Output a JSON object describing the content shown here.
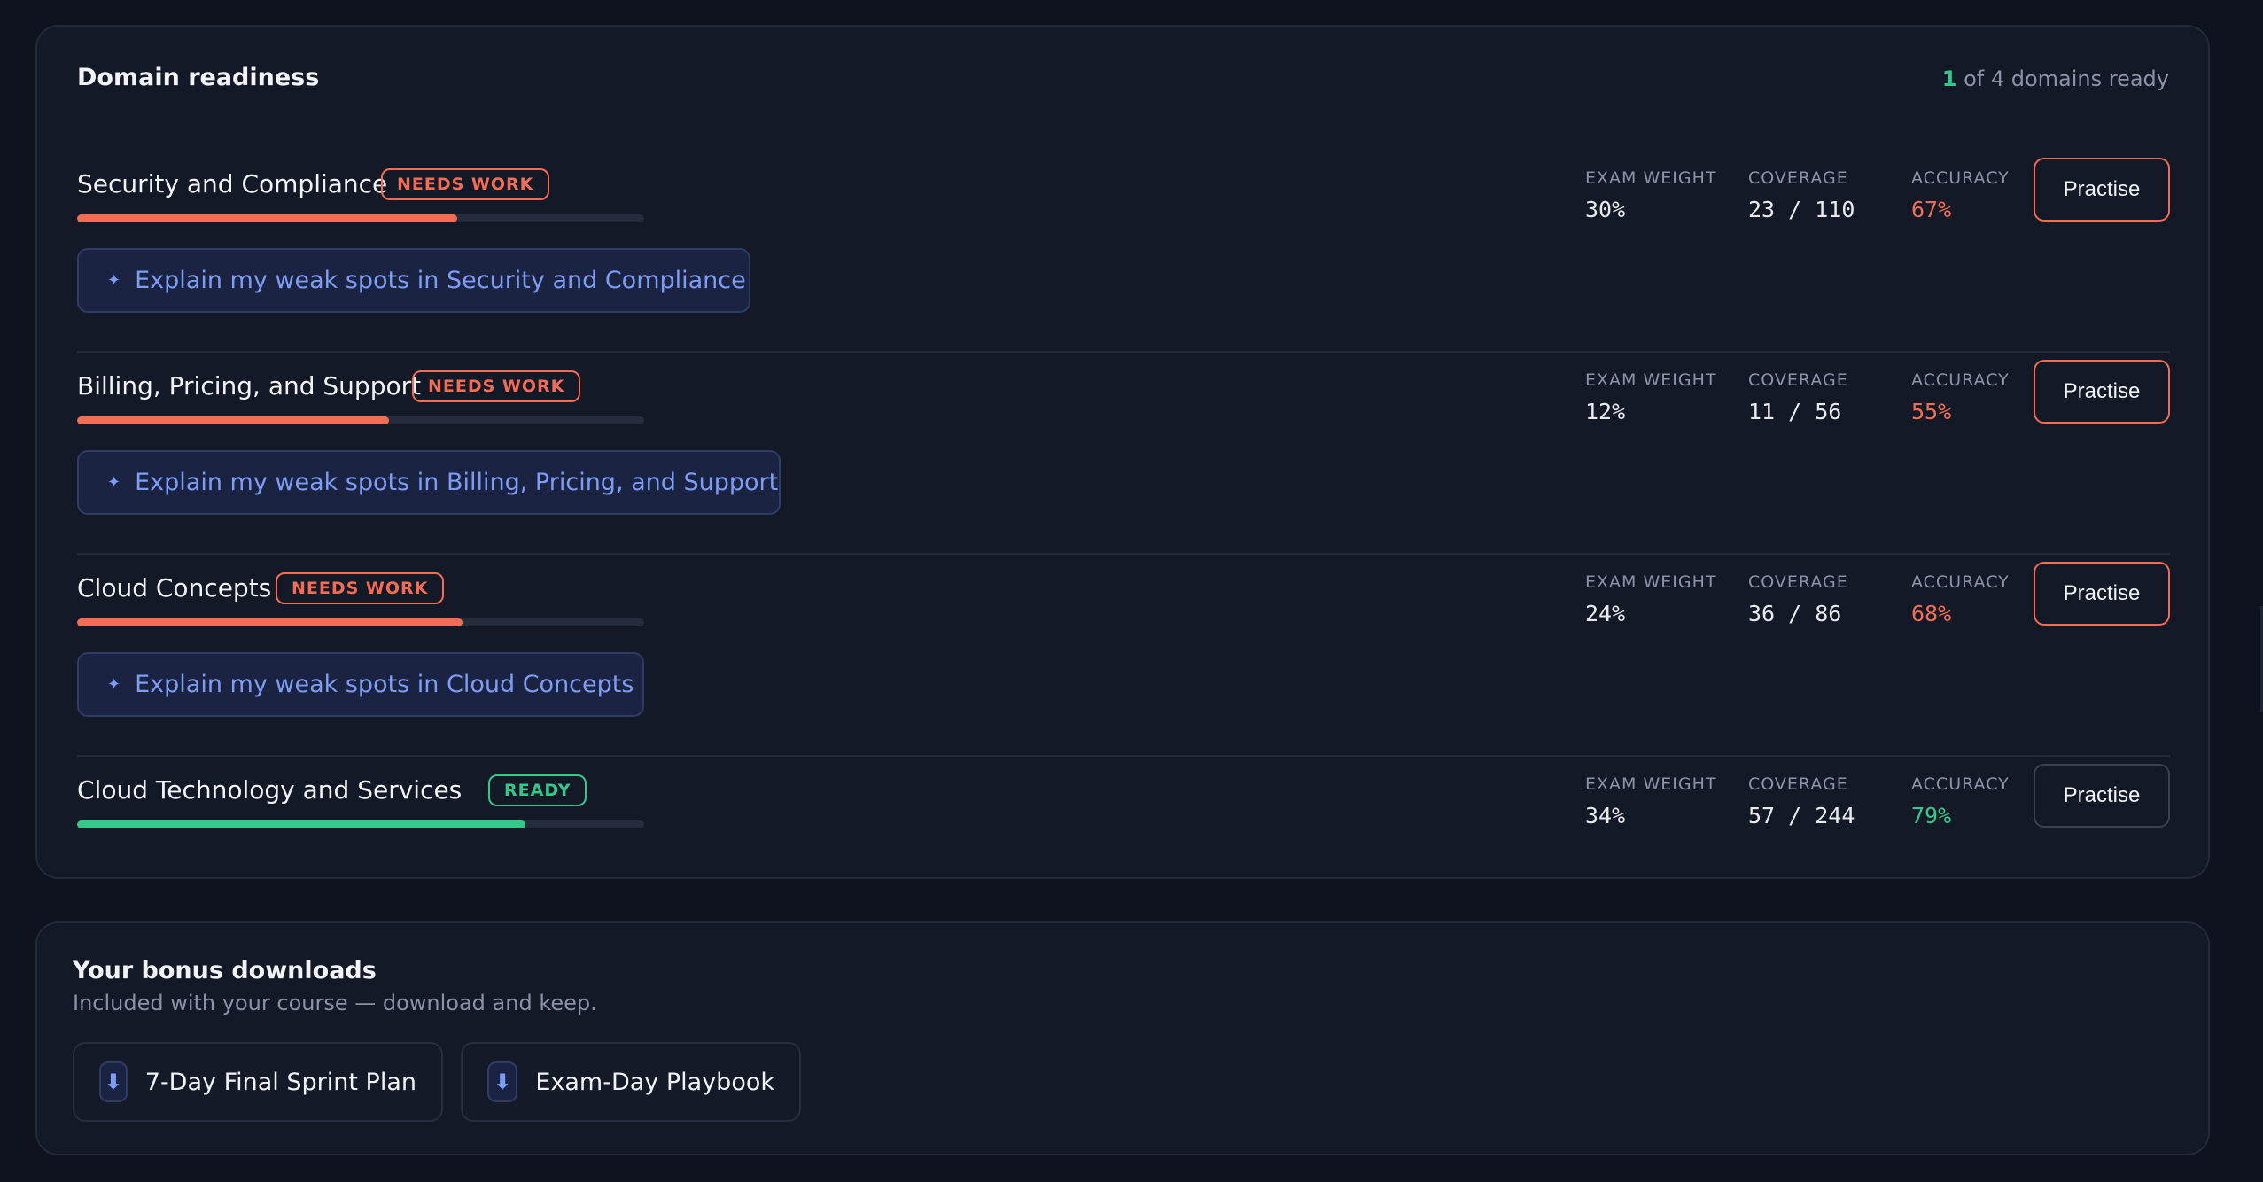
{
  "readiness": {
    "title": "Domain readiness",
    "summary_count": "1",
    "summary_text": " of 4 domains ready",
    "labels": {
      "exam_weight": "EXAM WEIGHT",
      "coverage": "COVERAGE",
      "accuracy": "ACCURACY",
      "practise": "Practise"
    },
    "domains": [
      {
        "name": "Security and Compliance",
        "badge": "NEEDS WORK",
        "progress": 0.67,
        "explain": "Explain my weak spots in Security and Compliance",
        "exam_weight": "30%",
        "coverage": "23 / 110",
        "accuracy": "67%"
      },
      {
        "name": "Billing, Pricing, and Support",
        "badge": "NEEDS WORK",
        "progress": 0.55,
        "explain": "Explain my weak spots in Billing, Pricing, and Support",
        "exam_weight": "12%",
        "coverage": "11 / 56",
        "accuracy": "55%"
      },
      {
        "name": "Cloud Concepts",
        "badge": "NEEDS WORK",
        "progress": 0.68,
        "explain": "Explain my weak spots in Cloud Concepts",
        "exam_weight": "24%",
        "coverage": "36 / 86",
        "accuracy": "68%"
      },
      {
        "name": "Cloud Technology and Services",
        "badge": "READY",
        "progress": 0.79,
        "exam_weight": "34%",
        "coverage": "57 / 244",
        "accuracy": "79%"
      }
    ]
  },
  "downloads": {
    "title": "Your bonus downloads",
    "subtitle": "Included with your course — download and keep.",
    "items": [
      {
        "label": "7-Day Final Sprint Plan",
        "icon": "download-icon"
      },
      {
        "label": "Exam-Day Playbook",
        "icon": "download-icon"
      }
    ]
  },
  "colors": {
    "needs_work": "#f26d55",
    "ready": "#34c98a",
    "accent": "#7f9cf5"
  }
}
